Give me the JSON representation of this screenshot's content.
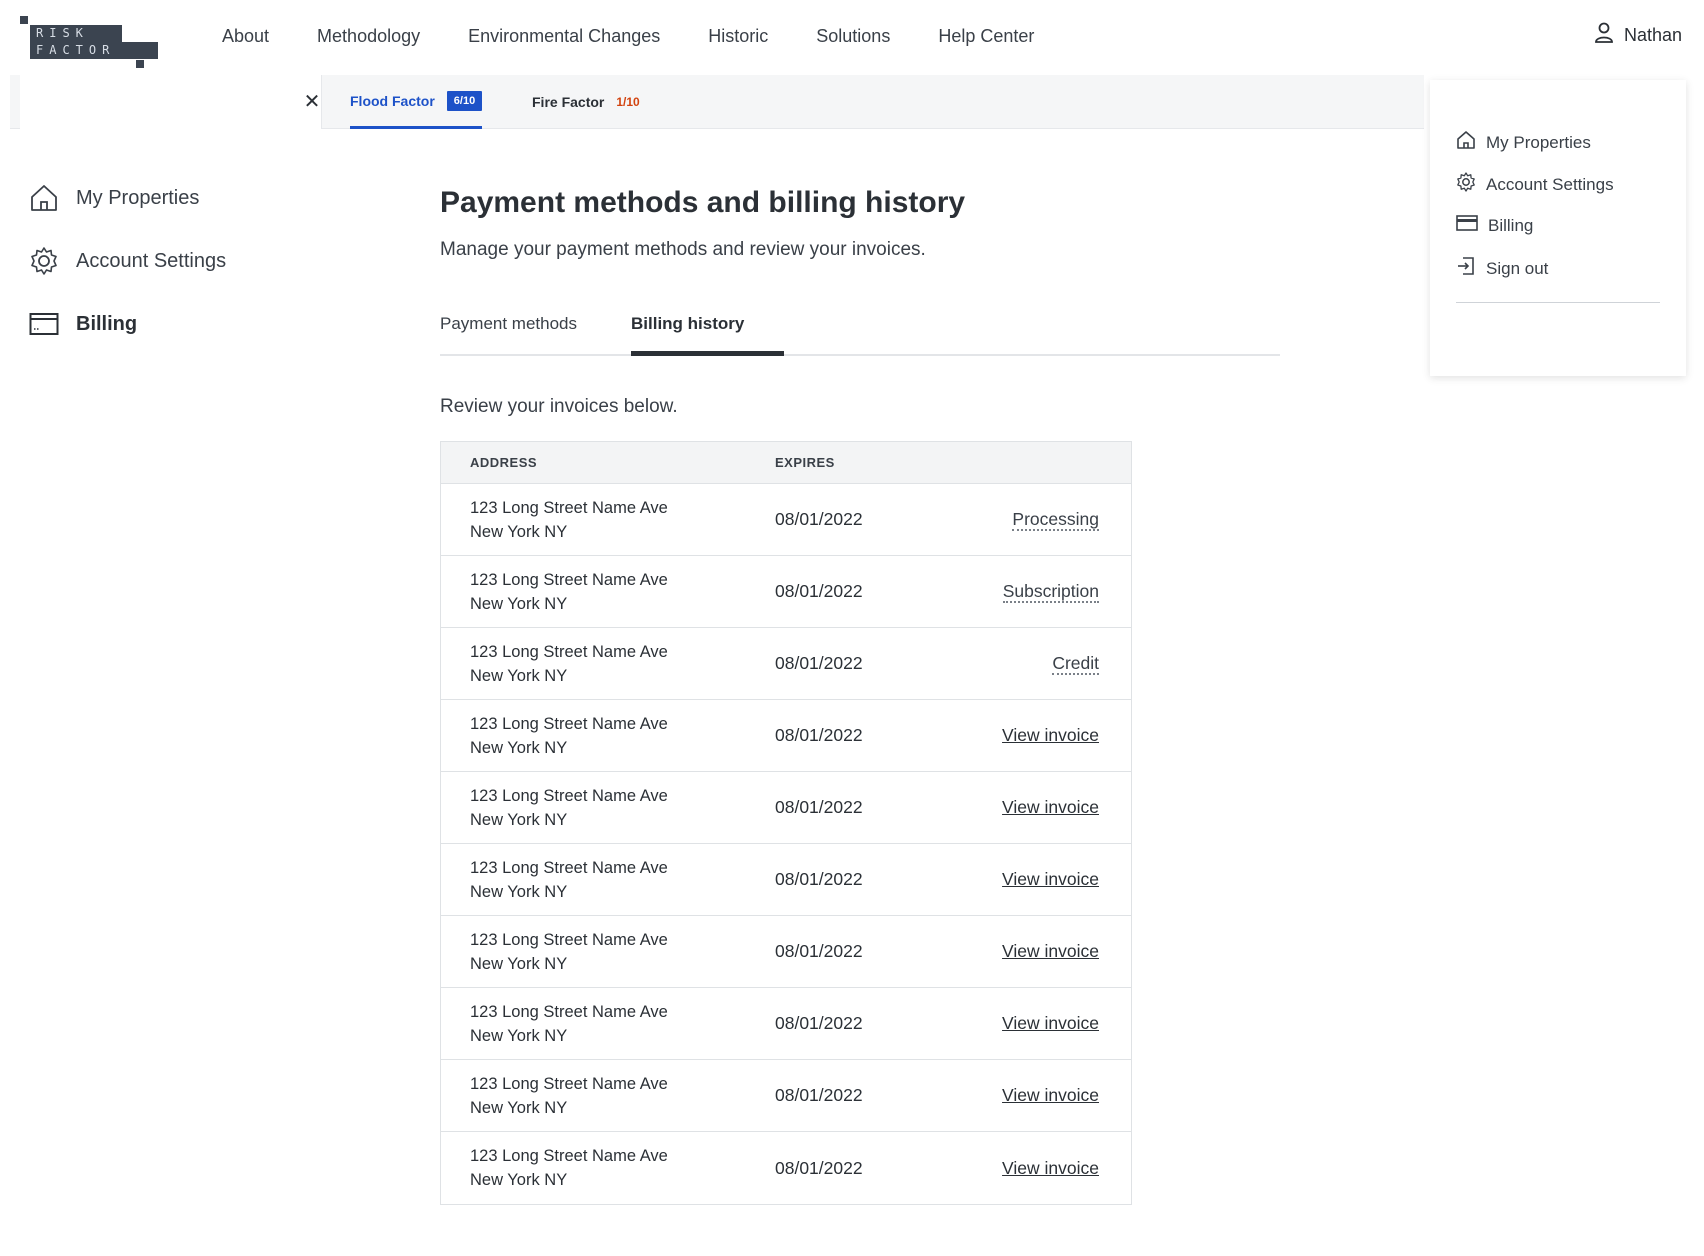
{
  "logo": {
    "line1": "RISK",
    "line2": "FACTOR"
  },
  "nav": {
    "links": [
      "About",
      "Methodology",
      "Environmental Changes",
      "Historic",
      "Solutions",
      "Help Center"
    ],
    "user": "Nathan"
  },
  "subbar": {
    "search": {
      "value": "",
      "placeholder": ""
    },
    "flood": {
      "label": "Flood Factor",
      "score": "6/10"
    },
    "fire": {
      "label": "Fire Factor",
      "score": "1/10"
    }
  },
  "sidebar": {
    "items": [
      {
        "label": "My Properties",
        "icon": "home-icon"
      },
      {
        "label": "Account Settings",
        "icon": "gear-icon"
      },
      {
        "label": "Billing",
        "icon": "credit-card-icon"
      }
    ]
  },
  "main": {
    "title": "Payment methods and billing history",
    "subtitle": "Manage your payment methods and review your invoices.",
    "tabs": [
      "Payment methods",
      "Billing history"
    ],
    "intro": "Review your invoices below.",
    "table": {
      "headers": [
        "ADDRESS",
        "EXPIRES"
      ],
      "rows": [
        {
          "line1": "123 Long Street Name Ave",
          "line2": "New York NY",
          "expires": "08/01/2022",
          "action": "Processing"
        },
        {
          "line1": "123 Long Street Name Ave",
          "line2": "New York NY",
          "expires": "08/01/2022",
          "action": "Subscription"
        },
        {
          "line1": "123 Long Street Name Ave",
          "line2": "New York NY",
          "expires": "08/01/2022",
          "action": "Credit"
        },
        {
          "line1": "123 Long Street Name Ave",
          "line2": "New York NY",
          "expires": "08/01/2022",
          "action": "View invoice"
        },
        {
          "line1": "123 Long Street Name Ave",
          "line2": "New York NY",
          "expires": "08/01/2022",
          "action": "View invoice"
        },
        {
          "line1": "123 Long Street Name Ave",
          "line2": "New York NY",
          "expires": "08/01/2022",
          "action": "View invoice"
        },
        {
          "line1": "123 Long Street Name Ave",
          "line2": "New York NY",
          "expires": "08/01/2022",
          "action": "View invoice"
        },
        {
          "line1": "123 Long Street Name Ave",
          "line2": "New York NY",
          "expires": "08/01/2022",
          "action": "View invoice"
        },
        {
          "line1": "123 Long Street Name Ave",
          "line2": "New York NY",
          "expires": "08/01/2022",
          "action": "View invoice"
        },
        {
          "line1": "123 Long Street Name Ave",
          "line2": "New York NY",
          "expires": "08/01/2022",
          "action": "View invoice"
        }
      ]
    }
  },
  "dropdown": {
    "items": [
      {
        "label": "My Properties",
        "icon": "home-icon"
      },
      {
        "label": "Account Settings",
        "icon": "gear-icon"
      },
      {
        "label": "Billing",
        "icon": "credit-card-icon"
      },
      {
        "label": "Sign out",
        "icon": "sign-out-icon"
      }
    ]
  },
  "colors": {
    "accent": "#1d52c8",
    "fire": "#d2430f",
    "text": "#2b3036"
  }
}
